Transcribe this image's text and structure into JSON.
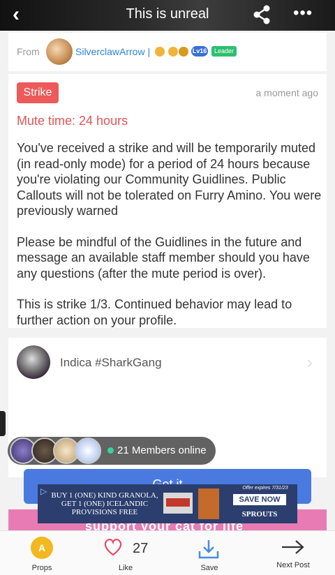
{
  "header": {
    "title": "This is unreal",
    "back_icon": "chevron-left-icon",
    "share_icon": "share-icon",
    "more_icon": "more-dots-icon",
    "more_glyph": "•••"
  },
  "from": {
    "label": "From",
    "username": "SilverclawArrow |",
    "level": "Lv16",
    "role": "Leader"
  },
  "strike": {
    "tag": "Strike",
    "time": "a moment ago",
    "mute_time": "Mute time: 24 hours",
    "paragraphs": [
      "You've received a strike and will be temporarily muted (in read-only mode) for a period of 24 hours because you're violating our Community Guidlines. Public Callouts will not be tolerated on Furry Amino. You were previously warned",
      "Please be mindful of the Guidlines in the future and message an available staff member should you have any questions (after the mute period is over).",
      "This is strike 1/3. Continued behavior may lead to further action on your profile."
    ]
  },
  "author": {
    "name": "Indica #SharkGang",
    "chevron": "›"
  },
  "members": {
    "online_text": "21 Members online"
  },
  "join_button": {
    "label": "Get it"
  },
  "ad": {
    "info_glyph": "▷",
    "headline": "BUY 1 (ONE) KIND GRANOLA, GET 1 (ONE) ICELANDIC PROVISIONS FREE",
    "offer": "Offer expires 7/31/23",
    "cta": "SAVE NOW",
    "brand": "SPROUTS",
    "strip_text": "support your cat for life"
  },
  "bottom_bar": {
    "props_label": "Props",
    "props_glyph": "A",
    "like_label": "Like",
    "like_count": "27",
    "save_label": "Save",
    "next_label": "Next Post"
  },
  "colors": {
    "accent_blue": "#4a7ae0",
    "strike_red": "#ec5a5a",
    "link_blue": "#2d86d8",
    "online_green": "#37d39a",
    "props_gold": "#f2b81f"
  }
}
